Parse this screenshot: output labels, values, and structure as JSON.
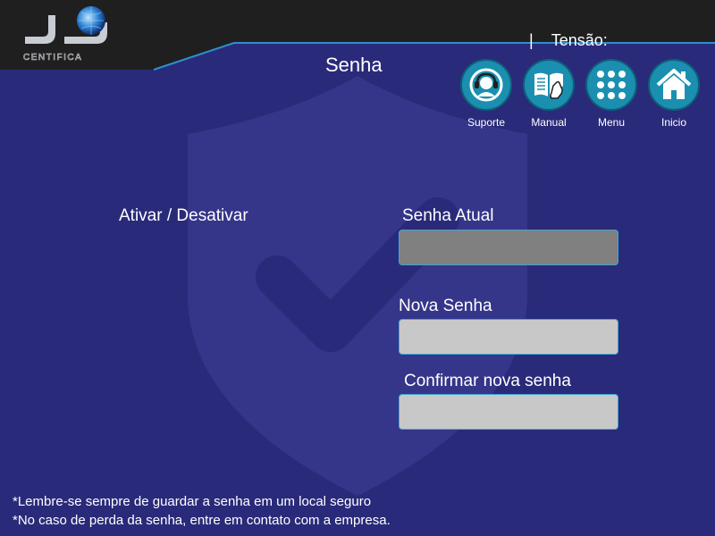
{
  "header": {
    "logo_text": "CENTIFICA",
    "separator": "|",
    "tensao_label": "Tensão:",
    "tensao_value": ""
  },
  "page": {
    "title": "Senha"
  },
  "nav": [
    {
      "label": "Suporte",
      "icon": "headset-icon"
    },
    {
      "label": "Manual",
      "icon": "book-icon"
    },
    {
      "label": "Menu",
      "icon": "grid-icon"
    },
    {
      "label": "Inicio",
      "icon": "home-icon"
    }
  ],
  "form": {
    "toggle_label": "Ativar / Desativar",
    "current_label": "Senha Atual",
    "current_value": "",
    "new_label": "Nova Senha",
    "new_value": "",
    "confirm_label": "Confirmar nova senha",
    "confirm_value": ""
  },
  "notes": [
    "*Lembre-se sempre de guardar a senha em um local seguro",
    "*No caso de perda da senha, entre em contato com a empresa."
  ],
  "colors": {
    "background": "#2a2a7a",
    "topbar": "#1f1f1f",
    "accent": "#1a8fb0",
    "field_border": "#3fa6d1"
  }
}
